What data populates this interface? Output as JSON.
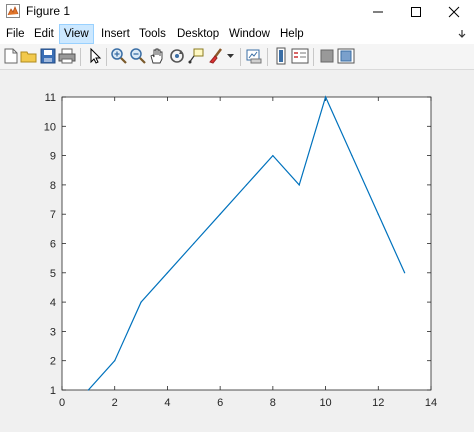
{
  "window": {
    "title": "Figure 1",
    "icon": "matlab-figure-icon"
  },
  "window_controls": [
    "minimize-icon",
    "maximize-icon",
    "close-icon"
  ],
  "menu": {
    "items": [
      {
        "label": "File"
      },
      {
        "label": "Edit"
      },
      {
        "label": "View",
        "active": true
      },
      {
        "label": "Insert"
      },
      {
        "label": "Tools"
      },
      {
        "label": "Desktop"
      },
      {
        "label": "Window"
      },
      {
        "label": "Help"
      }
    ],
    "dock_arrow": "dock-arrow-icon"
  },
  "toolbar": {
    "icons": [
      "new-figure-icon",
      "open-file-icon",
      "save-icon",
      "print-icon",
      "edit-plot-arrow-icon",
      "zoom-in-icon",
      "zoom-out-icon",
      "pan-hand-icon",
      "rotate-3d-icon",
      "data-cursor-icon",
      "brush-icon",
      "link-plot-icon",
      "insert-colorbar-icon",
      "insert-legend-icon",
      "hide-plot-tools-icon",
      "show-plot-tools-icon"
    ]
  },
  "colors": {
    "line": "#0072bd",
    "axes_bg": "#ffffff",
    "figure_bg": "#f0f0f0",
    "text": "#262626"
  },
  "chart_data": {
    "type": "line",
    "title": "",
    "xlabel": "",
    "ylabel": "",
    "xlim": [
      0,
      14
    ],
    "ylim": [
      1,
      11
    ],
    "xticks": [
      0,
      2,
      4,
      6,
      8,
      10,
      12,
      14
    ],
    "yticks": [
      1,
      2,
      3,
      4,
      5,
      6,
      7,
      8,
      9,
      10,
      11
    ],
    "grid": false,
    "series": [
      {
        "x": [
          1,
          2,
          3,
          4,
          5,
          6,
          7,
          8,
          9,
          10,
          11,
          12,
          13
        ],
        "y": [
          1,
          2,
          4,
          5,
          6,
          7,
          8,
          9,
          8,
          11,
          9,
          7,
          5
        ]
      }
    ]
  }
}
